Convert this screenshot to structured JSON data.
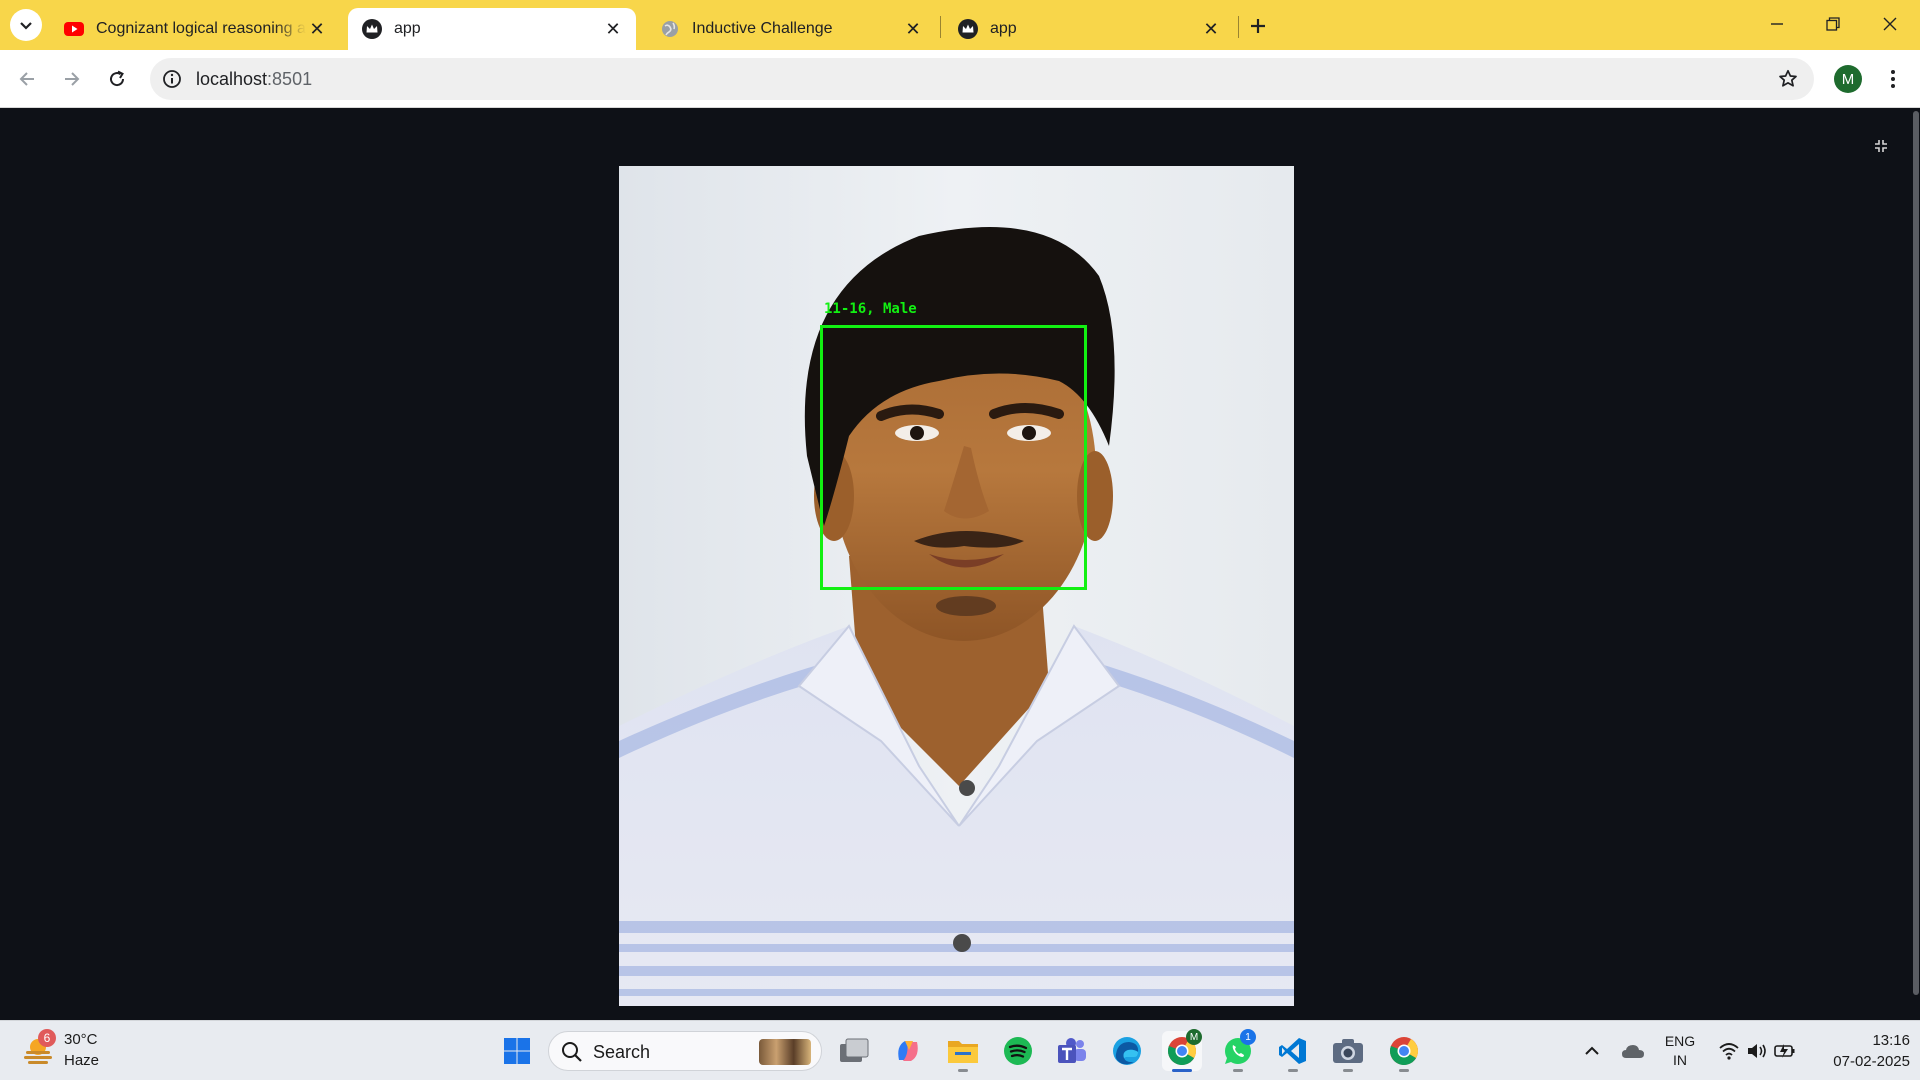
{
  "browser": {
    "tabs": [
      {
        "title": "Cognizant logical reasoning act",
        "favicon": "youtube-icon",
        "active": false
      },
      {
        "title": "app",
        "favicon": "streamlit-crown-icon",
        "active": true
      },
      {
        "title": "Inductive Challenge",
        "favicon": "globe-icon",
        "active": false
      },
      {
        "title": "app",
        "favicon": "streamlit-crown-icon",
        "active": false
      }
    ],
    "address": {
      "host": "localhost",
      "port": ":8501"
    },
    "profile_initial": "M",
    "accent_color": "#f8d64a"
  },
  "page": {
    "background": "#0e1117",
    "detection": {
      "label": "11-16, Male",
      "box_color": "#12f012"
    }
  },
  "taskbar": {
    "weather": {
      "temp": "30°C",
      "desc": "Haze",
      "badge": "6"
    },
    "search_label": "Search",
    "whatsapp_badge": "1",
    "chrome_profile_badge": "M",
    "tray": {
      "lang_line1": "ENG",
      "lang_line2": "IN"
    },
    "clock": {
      "time": "13:16",
      "date": "07-02-2025"
    }
  }
}
